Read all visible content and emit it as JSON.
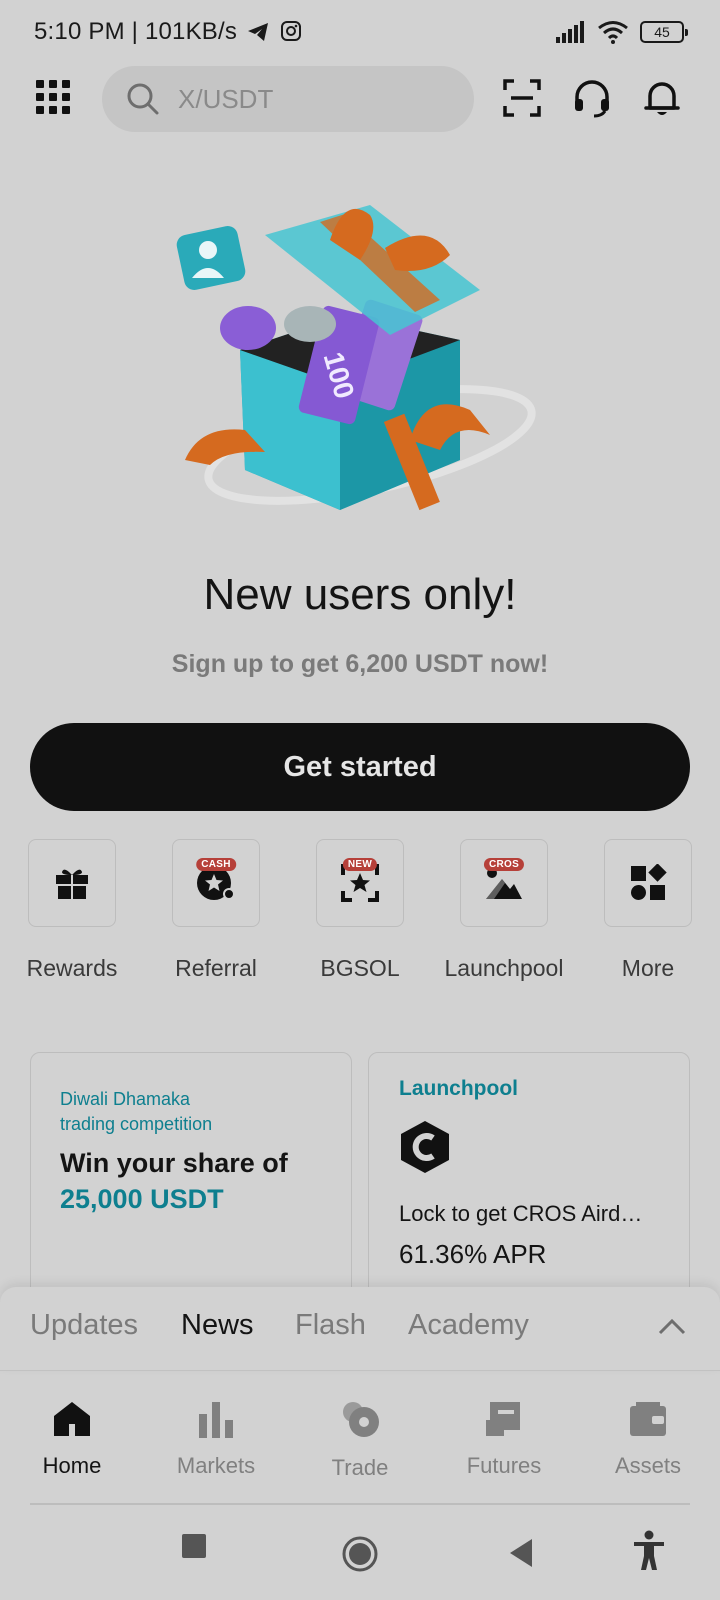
{
  "status_bar": {
    "time_speed": "5:10 PM | 101KB/s",
    "battery": "45"
  },
  "search": {
    "placeholder": "X/USDT"
  },
  "hero": {
    "coupon_value": "100",
    "headline": "New users only!",
    "subline": "Sign up to get 6,200 USDT now!",
    "cta_label": "Get started"
  },
  "quick_actions": [
    {
      "label": "Rewards",
      "badge": "",
      "icon": "gift-icon"
    },
    {
      "label": "Referral",
      "badge": "CASH",
      "icon": "referral-icon"
    },
    {
      "label": "BGSOL",
      "badge": "NEW",
      "icon": "bgsol-icon"
    },
    {
      "label": "Launchpool",
      "badge": "CROS",
      "icon": "launchpool-icon"
    },
    {
      "label": "More",
      "badge": "",
      "icon": "more-shapes-icon"
    }
  ],
  "cards": {
    "promo": {
      "kicker_line1": "Diwali Dhamaka",
      "kicker_line2": "trading competition",
      "title_line1": "Win your share of",
      "title_line2": "25,000 USDT"
    },
    "launchpool": {
      "kicker": "Launchpool",
      "description": "Lock to get CROS Aird…",
      "apr": "61.36% APR"
    }
  },
  "news_tabs": [
    "Updates",
    "News",
    "Flash",
    "Academy"
  ],
  "active_news_tab": "News",
  "bottom_nav": [
    {
      "label": "Home",
      "icon": "home-icon"
    },
    {
      "label": "Markets",
      "icon": "markets-icon"
    },
    {
      "label": "Trade",
      "icon": "trade-icon"
    },
    {
      "label": "Futures",
      "icon": "futures-icon"
    },
    {
      "label": "Assets",
      "icon": "assets-icon"
    }
  ],
  "active_nav": "Home",
  "colors": {
    "background": "#d2d2d2",
    "cta": "#111111",
    "accent_teal": "#0e7f8f",
    "badge_red": "#b64039"
  }
}
